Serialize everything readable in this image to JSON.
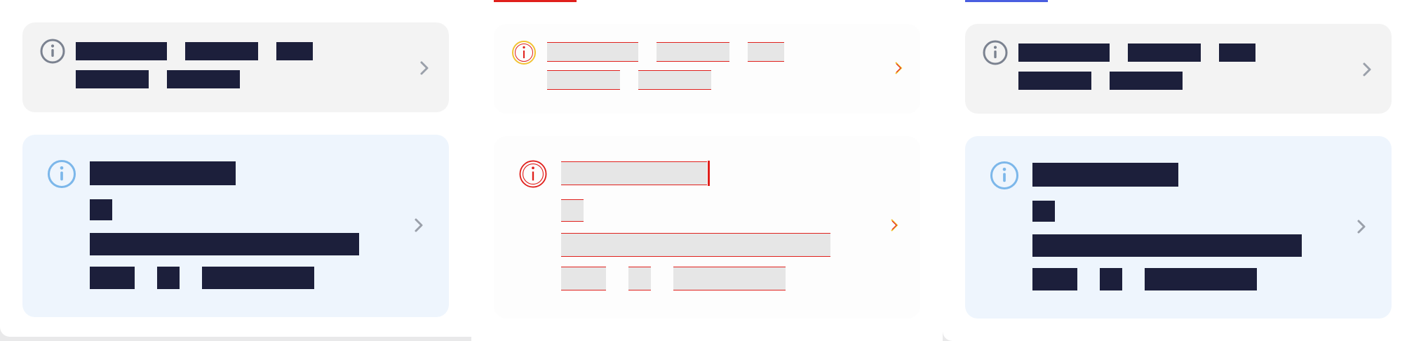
{
  "colors": {
    "panel_background": "#ffffff",
    "neutral_card": "#f3f3f3",
    "info_card": "#eef5fd",
    "redacted_text": "#1c1f3b",
    "neutral_icon": "#7b8290",
    "info_icon": "#7cb7ea",
    "chevron": "#9aa0aa",
    "tab_accent_red": "#e0201c",
    "tab_accent_blue": "#4a5ee0",
    "debug_outline": "#e0201c",
    "debug_fill": "#e6e6e6",
    "debug_icon_yellow": "#f2c233"
  },
  "icons": {
    "info": "info-circle-icon",
    "chevron": "chevron-right-icon"
  }
}
